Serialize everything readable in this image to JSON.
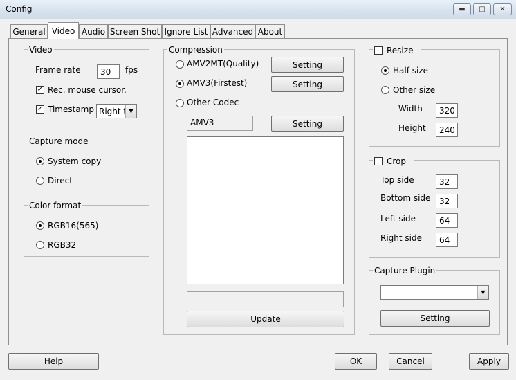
{
  "window": {
    "title": "Config"
  },
  "tabs": [
    {
      "label": "General"
    },
    {
      "label": "Video"
    },
    {
      "label": "Audio"
    },
    {
      "label": "Screen Shot"
    },
    {
      "label": "Ignore List"
    },
    {
      "label": "Advanced"
    },
    {
      "label": "About"
    }
  ],
  "video": {
    "legend": "Video",
    "frame_rate_label": "Frame rate",
    "frame_rate_value": "30",
    "fps_label": "fps",
    "rec_mouse_label": "Rec. mouse cursor.",
    "timestamp_label": "Timestamp",
    "timestamp_select": "Right to"
  },
  "capture_mode": {
    "legend": "Capture mode",
    "system_copy": "System copy",
    "direct": "Direct"
  },
  "color_format": {
    "legend": "Color format",
    "rgb16": "RGB16(565)",
    "rgb32": "RGB32"
  },
  "compression": {
    "legend": "Compression",
    "amv2mt": "AMV2MT(Quality)",
    "amv3": "AMV3(Firstest)",
    "other": "Other Codec",
    "setting": "Setting",
    "codec_value": "AMV3",
    "status_value": "",
    "update": "Update"
  },
  "resize": {
    "legend": "Resize",
    "half_size": "Half size",
    "other_size": "Other size",
    "width_label": "Width",
    "width_value": "320",
    "height_label": "Height",
    "height_value": "240"
  },
  "crop": {
    "legend": "Crop",
    "top_label": "Top side",
    "top_value": "32",
    "bottom_label": "Bottom side",
    "bottom_value": "32",
    "left_label": "Left side",
    "left_value": "64",
    "right_label": "Right side",
    "right_value": "64"
  },
  "capture_plugin": {
    "legend": "Capture Plugin",
    "select_value": "",
    "setting": "Setting"
  },
  "footer": {
    "help": "Help",
    "ok": "OK",
    "cancel": "Cancel",
    "apply": "Apply"
  },
  "icons": {
    "minimize": "minimize-icon",
    "maximize": "maximize-icon",
    "close": "close-icon"
  }
}
